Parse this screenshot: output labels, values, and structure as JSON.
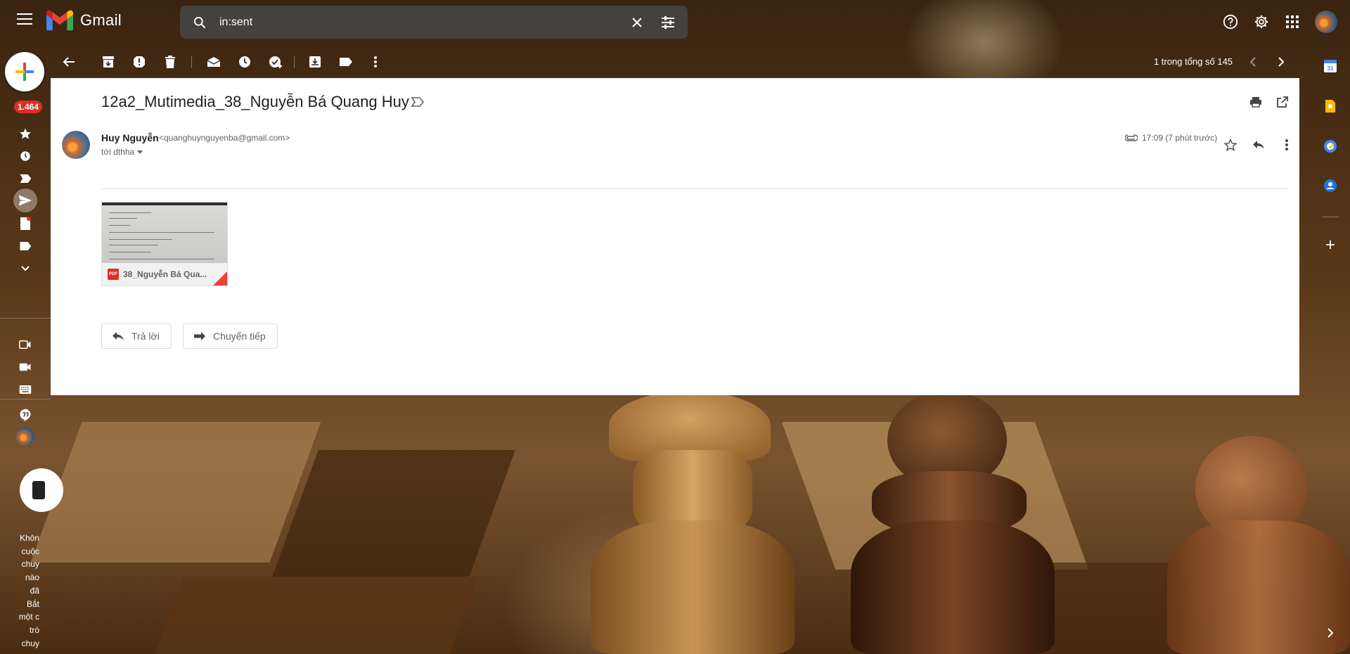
{
  "app": {
    "name": "Gmail"
  },
  "search": {
    "query": "in:sent"
  },
  "rail": {
    "unread_badge": "1.464",
    "hangouts_text_lines": [
      "Khôn",
      "cuộc",
      "chuy",
      "nào",
      "đã",
      "Bắt",
      "một c",
      "trò",
      "chuy"
    ]
  },
  "toolbar": {
    "pager_text": "1 trong tổng số 145"
  },
  "message": {
    "subject": "12a2_Mutimedia_38_Nguyễn Bá Quang Huy",
    "sender_name": "Huy Nguyễn",
    "sender_email": "<quanghuynguyenba@gmail.com>",
    "to_line": "tới dthha",
    "time": "17:09 (7 phút trước)",
    "attachment": {
      "name": "38_Nguyễn Bá Qua...",
      "type_label": "PDF"
    },
    "reply_label": "Trả lời",
    "forward_label": "Chuyển tiếp"
  },
  "colors": {
    "accent_red": "#d93025",
    "panel_bg": "#ffffff",
    "muted_text": "#5f6368"
  },
  "icons": [
    "menu-icon",
    "gmail-logo",
    "search-icon",
    "clear-icon",
    "filter-options-icon",
    "help-icon",
    "settings-icon",
    "apps-icon",
    "back-icon",
    "archive-icon",
    "spam-icon",
    "delete-icon",
    "mark-unread-icon",
    "snooze-icon",
    "add-task-icon",
    "move-to-icon",
    "label-icon",
    "more-icon",
    "chevron-left-icon",
    "chevron-right-icon",
    "print-icon",
    "open-new-window-icon",
    "attachment-clip-icon",
    "star-icon",
    "reply-icon",
    "calendar-icon",
    "keep-icon",
    "tasks-icon",
    "contacts-icon",
    "plus-icon"
  ]
}
